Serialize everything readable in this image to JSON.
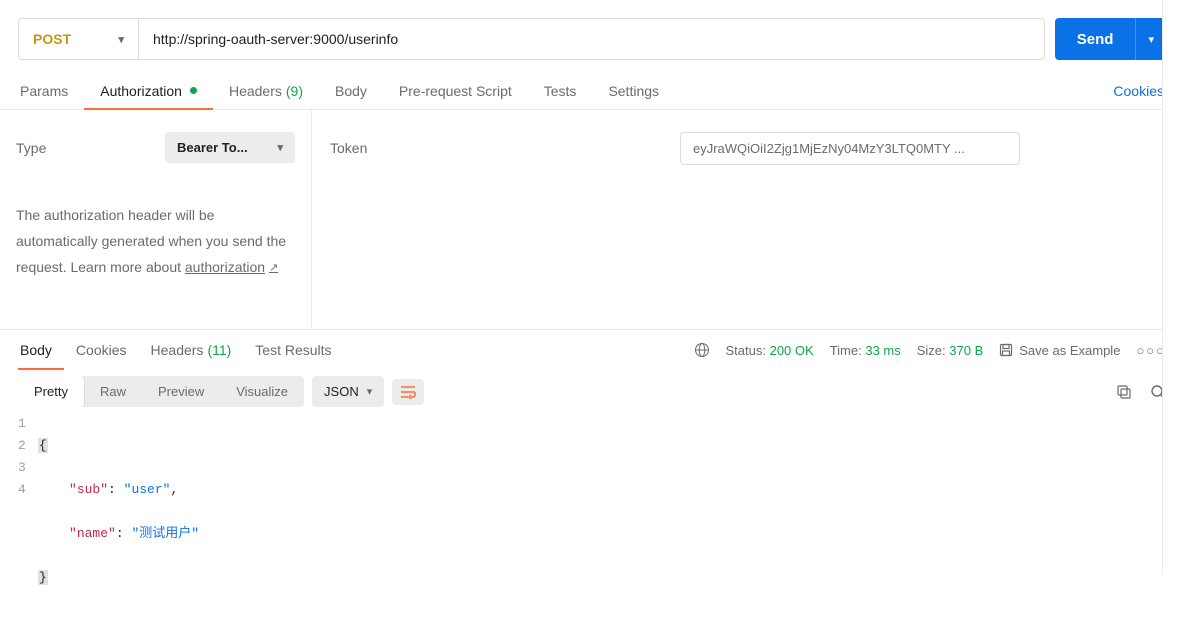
{
  "request": {
    "method": "POST",
    "url": "http://spring-oauth-server:9000/userinfo",
    "sendLabel": "Send",
    "tabs": {
      "params": "Params",
      "authorization": "Authorization",
      "headers": "Headers",
      "headersCount": "(9)",
      "body": "Body",
      "prerequest": "Pre-request Script",
      "tests": "Tests",
      "settings": "Settings"
    },
    "cookiesLink": "Cookies"
  },
  "auth": {
    "typeLabel": "Type",
    "typeValue": "Bearer To...",
    "desc1": "The authorization header will be automatically generated when you send the request. Learn more about ",
    "link": "authorization",
    "tokenLabel": "Token",
    "tokenValue": "eyJraWQiOiI2Zjg1MjEzNy04MzY3LTQ0MTY ..."
  },
  "response": {
    "tabs": {
      "body": "Body",
      "cookies": "Cookies",
      "headers": "Headers",
      "headersCount": "(11)",
      "testResults": "Test Results"
    },
    "statusLabel": "Status:",
    "statusValue": "200 OK",
    "timeLabel": "Time:",
    "timeValue": "33 ms",
    "sizeLabel": "Size:",
    "sizeValue": "370 B",
    "saveExample": "Save as Example",
    "view": {
      "pretty": "Pretty",
      "raw": "Raw",
      "preview": "Preview",
      "visualize": "Visualize",
      "format": "JSON"
    },
    "body": {
      "line1": "{",
      "l2_key": "\"sub\"",
      "l2_val": "\"user\"",
      "l3_key": "\"name\"",
      "l3_val": "\"测试用户\"",
      "line4": "}"
    },
    "ln1": "1",
    "ln2": "2",
    "ln3": "3",
    "ln4": "4"
  }
}
